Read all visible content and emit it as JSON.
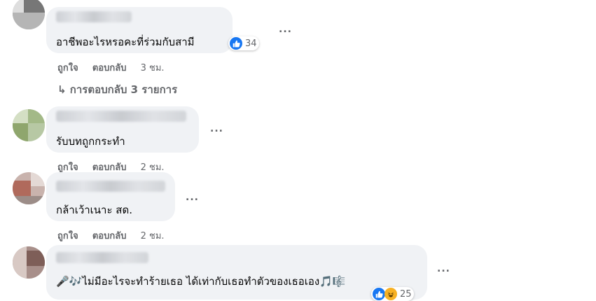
{
  "comments": [
    {
      "text": "อาชีพอะไรหรอคะที่ร่วมกับสามี",
      "like_count": "34",
      "like_label": "ถูกใจ",
      "reply_label": "ตอบกลับ",
      "time": "3 ชม."
    },
    {
      "text": "รับบทถูกกระทำ",
      "like_label": "ถูกใจ",
      "reply_label": "ตอบกลับ",
      "time": "2 ชม."
    },
    {
      "text": "กล้าเว้าเนาะ สด.",
      "like_label": "ถูกใจ",
      "reply_label": "ตอบกลับ",
      "time": "2 ชม."
    },
    {
      "text": "🎤🎶ไม่มีอะไรจะทำร้ายเธอ ได้เท่ากับเธอทำตัวของเธอเอง🎵🎼",
      "reaction_count": "25"
    }
  ],
  "replies_link": "↳ การตอบกลับ 3 รายการ",
  "more_label": "...",
  "icons": {
    "like": "thumbs-up-icon",
    "haha": "laughing-face-icon",
    "more": "more-options-icon"
  },
  "colors": {
    "bubble": "#f0f2f5",
    "like_blue": "#1877f2",
    "meta_gray": "#65676b"
  }
}
